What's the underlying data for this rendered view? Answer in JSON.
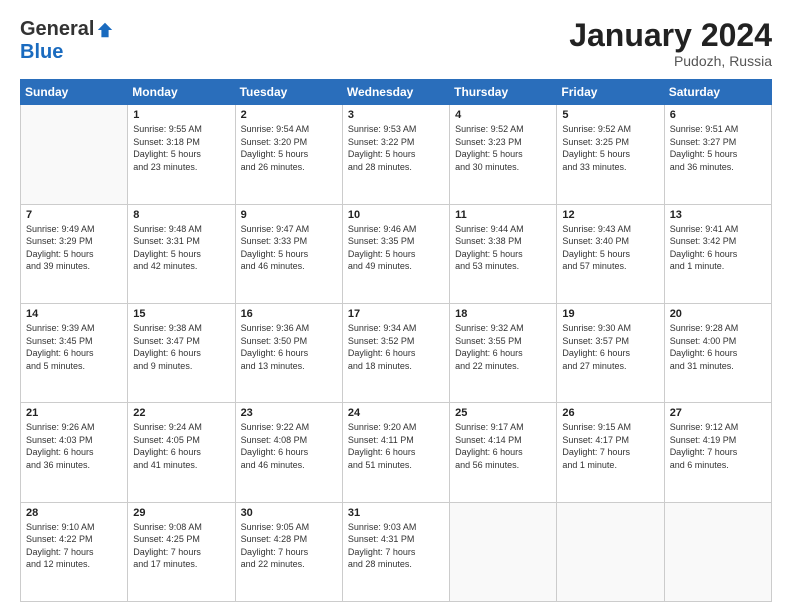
{
  "logo": {
    "general": "General",
    "blue": "Blue"
  },
  "title": "January 2024",
  "location": "Pudozh, Russia",
  "header": {
    "days": [
      "Sunday",
      "Monday",
      "Tuesday",
      "Wednesday",
      "Thursday",
      "Friday",
      "Saturday"
    ]
  },
  "weeks": [
    [
      {
        "day": "",
        "content": ""
      },
      {
        "day": "1",
        "content": "Sunrise: 9:55 AM\nSunset: 3:18 PM\nDaylight: 5 hours\nand 23 minutes."
      },
      {
        "day": "2",
        "content": "Sunrise: 9:54 AM\nSunset: 3:20 PM\nDaylight: 5 hours\nand 26 minutes."
      },
      {
        "day": "3",
        "content": "Sunrise: 9:53 AM\nSunset: 3:22 PM\nDaylight: 5 hours\nand 28 minutes."
      },
      {
        "day": "4",
        "content": "Sunrise: 9:52 AM\nSunset: 3:23 PM\nDaylight: 5 hours\nand 30 minutes."
      },
      {
        "day": "5",
        "content": "Sunrise: 9:52 AM\nSunset: 3:25 PM\nDaylight: 5 hours\nand 33 minutes."
      },
      {
        "day": "6",
        "content": "Sunrise: 9:51 AM\nSunset: 3:27 PM\nDaylight: 5 hours\nand 36 minutes."
      }
    ],
    [
      {
        "day": "7",
        "content": "Sunrise: 9:49 AM\nSunset: 3:29 PM\nDaylight: 5 hours\nand 39 minutes."
      },
      {
        "day": "8",
        "content": "Sunrise: 9:48 AM\nSunset: 3:31 PM\nDaylight: 5 hours\nand 42 minutes."
      },
      {
        "day": "9",
        "content": "Sunrise: 9:47 AM\nSunset: 3:33 PM\nDaylight: 5 hours\nand 46 minutes."
      },
      {
        "day": "10",
        "content": "Sunrise: 9:46 AM\nSunset: 3:35 PM\nDaylight: 5 hours\nand 49 minutes."
      },
      {
        "day": "11",
        "content": "Sunrise: 9:44 AM\nSunset: 3:38 PM\nDaylight: 5 hours\nand 53 minutes."
      },
      {
        "day": "12",
        "content": "Sunrise: 9:43 AM\nSunset: 3:40 PM\nDaylight: 5 hours\nand 57 minutes."
      },
      {
        "day": "13",
        "content": "Sunrise: 9:41 AM\nSunset: 3:42 PM\nDaylight: 6 hours\nand 1 minute."
      }
    ],
    [
      {
        "day": "14",
        "content": "Sunrise: 9:39 AM\nSunset: 3:45 PM\nDaylight: 6 hours\nand 5 minutes."
      },
      {
        "day": "15",
        "content": "Sunrise: 9:38 AM\nSunset: 3:47 PM\nDaylight: 6 hours\nand 9 minutes."
      },
      {
        "day": "16",
        "content": "Sunrise: 9:36 AM\nSunset: 3:50 PM\nDaylight: 6 hours\nand 13 minutes."
      },
      {
        "day": "17",
        "content": "Sunrise: 9:34 AM\nSunset: 3:52 PM\nDaylight: 6 hours\nand 18 minutes."
      },
      {
        "day": "18",
        "content": "Sunrise: 9:32 AM\nSunset: 3:55 PM\nDaylight: 6 hours\nand 22 minutes."
      },
      {
        "day": "19",
        "content": "Sunrise: 9:30 AM\nSunset: 3:57 PM\nDaylight: 6 hours\nand 27 minutes."
      },
      {
        "day": "20",
        "content": "Sunrise: 9:28 AM\nSunset: 4:00 PM\nDaylight: 6 hours\nand 31 minutes."
      }
    ],
    [
      {
        "day": "21",
        "content": "Sunrise: 9:26 AM\nSunset: 4:03 PM\nDaylight: 6 hours\nand 36 minutes."
      },
      {
        "day": "22",
        "content": "Sunrise: 9:24 AM\nSunset: 4:05 PM\nDaylight: 6 hours\nand 41 minutes."
      },
      {
        "day": "23",
        "content": "Sunrise: 9:22 AM\nSunset: 4:08 PM\nDaylight: 6 hours\nand 46 minutes."
      },
      {
        "day": "24",
        "content": "Sunrise: 9:20 AM\nSunset: 4:11 PM\nDaylight: 6 hours\nand 51 minutes."
      },
      {
        "day": "25",
        "content": "Sunrise: 9:17 AM\nSunset: 4:14 PM\nDaylight: 6 hours\nand 56 minutes."
      },
      {
        "day": "26",
        "content": "Sunrise: 9:15 AM\nSunset: 4:17 PM\nDaylight: 7 hours\nand 1 minute."
      },
      {
        "day": "27",
        "content": "Sunrise: 9:12 AM\nSunset: 4:19 PM\nDaylight: 7 hours\nand 6 minutes."
      }
    ],
    [
      {
        "day": "28",
        "content": "Sunrise: 9:10 AM\nSunset: 4:22 PM\nDaylight: 7 hours\nand 12 minutes."
      },
      {
        "day": "29",
        "content": "Sunrise: 9:08 AM\nSunset: 4:25 PM\nDaylight: 7 hours\nand 17 minutes."
      },
      {
        "day": "30",
        "content": "Sunrise: 9:05 AM\nSunset: 4:28 PM\nDaylight: 7 hours\nand 22 minutes."
      },
      {
        "day": "31",
        "content": "Sunrise: 9:03 AM\nSunset: 4:31 PM\nDaylight: 7 hours\nand 28 minutes."
      },
      {
        "day": "",
        "content": ""
      },
      {
        "day": "",
        "content": ""
      },
      {
        "day": "",
        "content": ""
      }
    ]
  ]
}
